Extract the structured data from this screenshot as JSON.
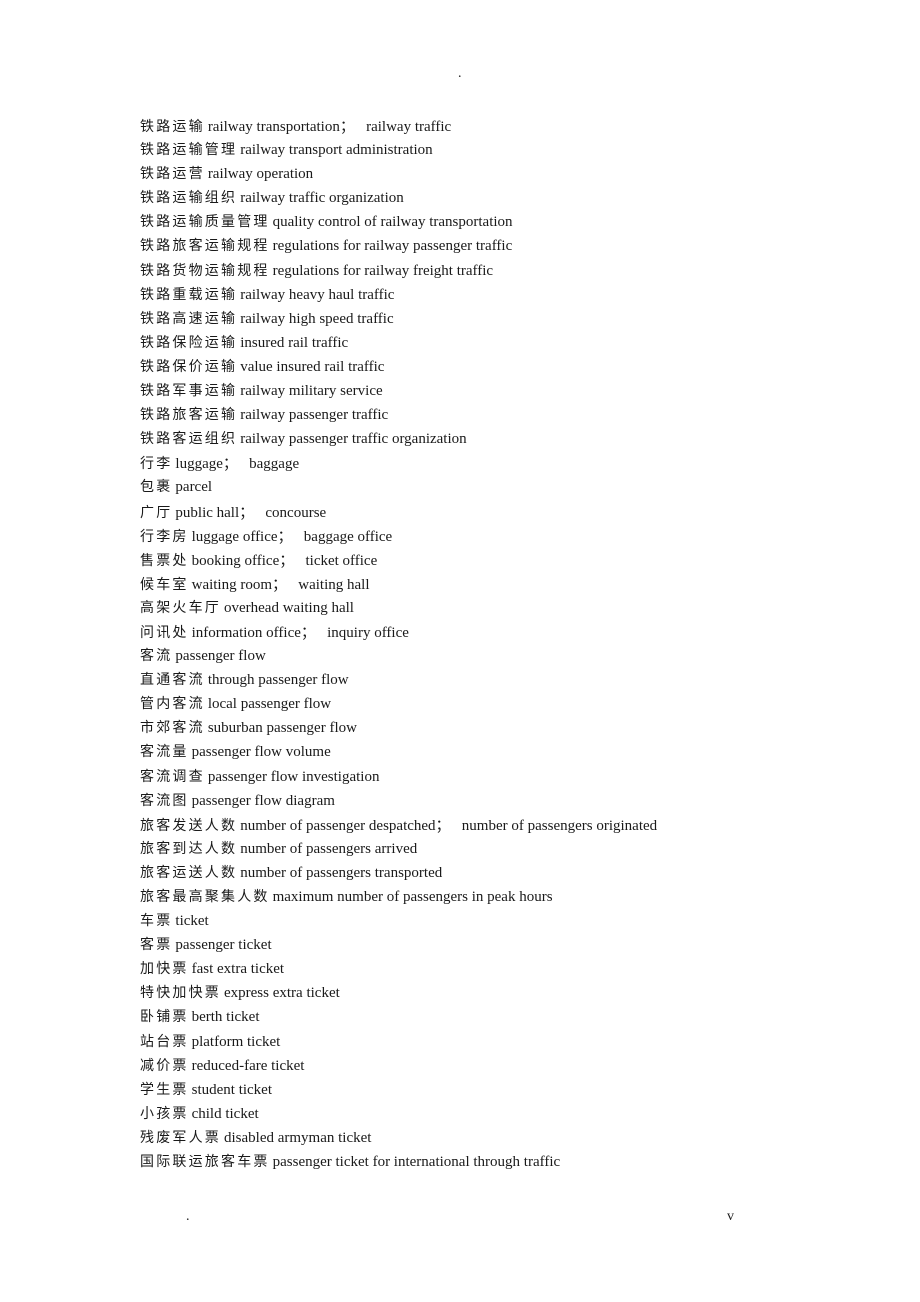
{
  "header": {
    "mark": "."
  },
  "footer": {
    "left_mark": ".",
    "right_mark": "v"
  },
  "entries": [
    {
      "zh": "铁路运输",
      "en": "railway transportation；   railway traffic"
    },
    {
      "zh": "铁路运输管理",
      "en": "railway transport administration"
    },
    {
      "zh": "铁路运营",
      "en": "railway operation"
    },
    {
      "zh": "铁路运输组织",
      "en": "railway traffic organization"
    },
    {
      "zh": "铁路运输质量管理",
      "en": "quality control of railway transportation"
    },
    {
      "zh": "铁路旅客运输规程",
      "en": "regulations for railway passenger traffic"
    },
    {
      "zh": "铁路货物运输规程",
      "en": "regulations for railway freight traffic"
    },
    {
      "zh": "铁路重载运输",
      "en": "railway heavy haul traffic"
    },
    {
      "zh": "铁路高速运输",
      "en": "railway high speed traffic"
    },
    {
      "zh": "铁路保险运输",
      "en": "insured rail traffic"
    },
    {
      "zh": "铁路保价运输",
      "en": "value insured rail traffic"
    },
    {
      "zh": "铁路军事运输",
      "en": "railway military service"
    },
    {
      "zh": "铁路旅客运输",
      "en": "railway passenger traffic"
    },
    {
      "zh": "铁路客运组织",
      "en": "railway passenger traffic organization"
    },
    {
      "zh": "行李",
      "en": "luggage；   baggage"
    },
    {
      "zh": "包裹",
      "en": "parcel"
    },
    {
      "zh": "广厅",
      "en": "public hall；   concourse"
    },
    {
      "zh": "行李房",
      "en": "luggage office；   baggage office"
    },
    {
      "zh": "售票处",
      "en": "booking office；   ticket office"
    },
    {
      "zh": "候车室",
      "en": "waiting room；   waiting hall"
    },
    {
      "zh": "高架火车厅",
      "en": "overhead waiting hall"
    },
    {
      "zh": "问讯处",
      "en": "information office；   inquiry office"
    },
    {
      "zh": "客流",
      "en": "passenger flow"
    },
    {
      "zh": "直通客流",
      "en": "through passenger flow"
    },
    {
      "zh": "管内客流",
      "en": "local passenger flow"
    },
    {
      "zh": "市郊客流",
      "en": "suburban passenger flow"
    },
    {
      "zh": "客流量",
      "en": "passenger flow volume"
    },
    {
      "zh": "客流调查",
      "en": "passenger flow investigation"
    },
    {
      "zh": "客流图",
      "en": "passenger flow diagram"
    },
    {
      "zh": "旅客发送人数",
      "en": "number of passenger despatched；   number of passengers originated"
    },
    {
      "zh": "旅客到达人数",
      "en": "number of passengers arrived"
    },
    {
      "zh": "旅客运送人数",
      "en": "number of passengers transported"
    },
    {
      "zh": "旅客最高聚集人数",
      "en": "maximum number of passengers in peak hours"
    },
    {
      "zh": "车票",
      "en": "ticket"
    },
    {
      "zh": "客票",
      "en": "passenger ticket"
    },
    {
      "zh": "加快票",
      "en": "fast extra ticket"
    },
    {
      "zh": "特快加快票",
      "en": "express extra ticket"
    },
    {
      "zh": "卧铺票",
      "en": "berth ticket"
    },
    {
      "zh": "站台票",
      "en": "platform ticket"
    },
    {
      "zh": "减价票",
      "en": "reduced-fare ticket"
    },
    {
      "zh": "学生票",
      "en": "student ticket"
    },
    {
      "zh": "小孩票",
      "en": "child ticket"
    },
    {
      "zh": "残废军人票",
      "en": "disabled armyman ticket"
    },
    {
      "zh": "国际联运旅客车票",
      "en": "passenger ticket for international through traffic"
    }
  ]
}
